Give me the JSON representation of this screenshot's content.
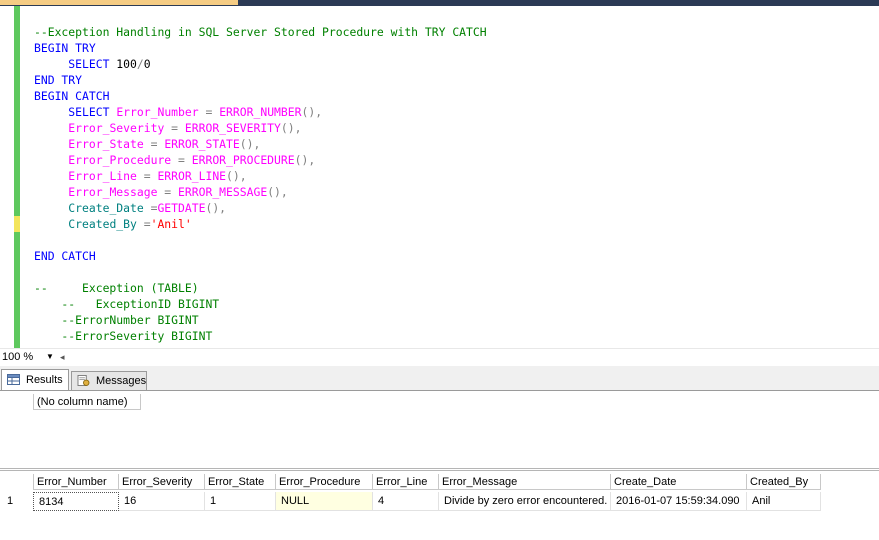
{
  "editor": {
    "lines": [
      [
        {
          "t": "--Exception Handling in SQL Server Stored Procedure with TRY CATCH",
          "c": "cm"
        }
      ],
      [
        {
          "t": "BEGIN TRY",
          "c": "kw"
        }
      ],
      [
        {
          "t": "     ",
          "c": "txt"
        },
        {
          "t": "SELECT",
          "c": "kw"
        },
        {
          "t": " 100",
          "c": "txt"
        },
        {
          "t": "/",
          "c": "op"
        },
        {
          "t": "0",
          "c": "txt"
        }
      ],
      [
        {
          "t": "END TRY",
          "c": "kw"
        }
      ],
      [
        {
          "t": "BEGIN CATCH",
          "c": "kw"
        }
      ],
      [
        {
          "t": "     ",
          "c": "txt"
        },
        {
          "t": "SELECT",
          "c": "kw"
        },
        {
          "t": " ",
          "c": "txt"
        },
        {
          "t": "Error_Number",
          "c": "fn"
        },
        {
          "t": " = ",
          "c": "op"
        },
        {
          "t": "ERROR_NUMBER",
          "c": "fn"
        },
        {
          "t": "(),",
          "c": "op"
        }
      ],
      [
        {
          "t": "     ",
          "c": "txt"
        },
        {
          "t": "Error_Severity",
          "c": "fn"
        },
        {
          "t": " = ",
          "c": "op"
        },
        {
          "t": "ERROR_SEVERITY",
          "c": "fn"
        },
        {
          "t": "(),",
          "c": "op"
        }
      ],
      [
        {
          "t": "     ",
          "c": "txt"
        },
        {
          "t": "Error_State",
          "c": "fn"
        },
        {
          "t": " = ",
          "c": "op"
        },
        {
          "t": "ERROR_STATE",
          "c": "fn"
        },
        {
          "t": "(),",
          "c": "op"
        }
      ],
      [
        {
          "t": "     ",
          "c": "txt"
        },
        {
          "t": "Error_Procedure",
          "c": "fn"
        },
        {
          "t": " = ",
          "c": "op"
        },
        {
          "t": "ERROR_PROCEDURE",
          "c": "fn"
        },
        {
          "t": "(),",
          "c": "op"
        }
      ],
      [
        {
          "t": "     ",
          "c": "txt"
        },
        {
          "t": "Error_Line",
          "c": "fn"
        },
        {
          "t": " = ",
          "c": "op"
        },
        {
          "t": "ERROR_LINE",
          "c": "fn"
        },
        {
          "t": "(),",
          "c": "op"
        }
      ],
      [
        {
          "t": "     ",
          "c": "txt"
        },
        {
          "t": "Error_Message",
          "c": "fn"
        },
        {
          "t": " = ",
          "c": "op"
        },
        {
          "t": "ERROR_MESSAGE",
          "c": "fn"
        },
        {
          "t": "(),",
          "c": "op"
        }
      ],
      [
        {
          "t": "     ",
          "c": "txt"
        },
        {
          "t": "Create_Date",
          "c": "col"
        },
        {
          "t": " =",
          "c": "op"
        },
        {
          "t": "GETDATE",
          "c": "fn"
        },
        {
          "t": "(),",
          "c": "op"
        }
      ],
      [
        {
          "t": "     ",
          "c": "txt"
        },
        {
          "t": "Created_By",
          "c": "col"
        },
        {
          "t": " =",
          "c": "op"
        },
        {
          "t": "'Anil'",
          "c": "str"
        }
      ],
      [],
      [
        {
          "t": "END CATCH",
          "c": "kw"
        }
      ],
      [],
      [
        {
          "t": "--     Exception (TABLE)",
          "c": "cm"
        }
      ],
      [
        {
          "t": "    --   ExceptionID BIGINT",
          "c": "cm"
        }
      ],
      [
        {
          "t": "    --ErrorNumber BIGINT",
          "c": "cm"
        }
      ],
      [
        {
          "t": "    --ErrorSeverity BIGINT",
          "c": "cm"
        }
      ]
    ]
  },
  "zoom": {
    "value": "100 %"
  },
  "tabs": {
    "results": "Results",
    "messages": "Messages"
  },
  "grid1": {
    "header": "(No column name)"
  },
  "grid2": {
    "columns": [
      "Error_Number",
      "Error_Severity",
      "Error_State",
      "Error_Procedure",
      "Error_Line",
      "Error_Message",
      "Create_Date",
      "Created_By"
    ],
    "rows": [
      {
        "num": "1",
        "cells": [
          "8134",
          "16",
          "1",
          "NULL",
          "4",
          "Divide by zero error encountered.",
          "2016-01-07 15:59:34.090",
          "Anil"
        ]
      }
    ]
  },
  "colors": {
    "keyword": "#0000ff",
    "function": "#ff00ff",
    "comment": "#008000",
    "string": "#ff0000",
    "column": "#008080",
    "changebar": "#5ec85e",
    "null_bg": "#ffffe1"
  }
}
